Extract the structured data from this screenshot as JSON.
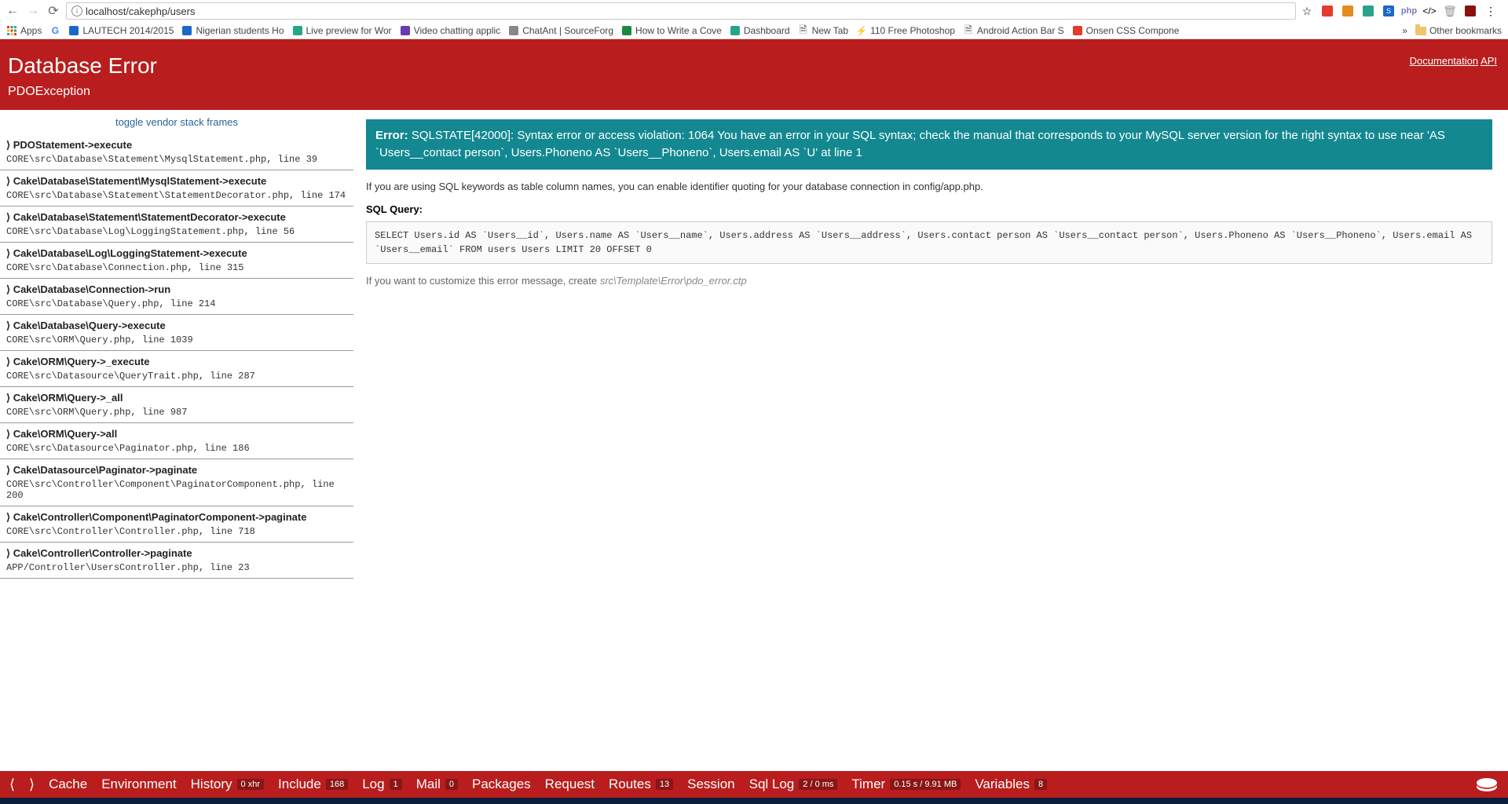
{
  "url": "localhost/cakephp/users",
  "bookmarks": {
    "apps": "Apps",
    "items": [
      {
        "label": "LAUTECH 2014/2015"
      },
      {
        "label": "Nigerian students Ho"
      },
      {
        "label": "Live preview for Wor"
      },
      {
        "label": "Video chatting applic"
      },
      {
        "label": "ChatAnt | SourceForg"
      },
      {
        "label": "How to Write a Cove"
      },
      {
        "label": "Dashboard"
      },
      {
        "label": "New Tab"
      },
      {
        "label": "110 Free Photoshop"
      },
      {
        "label": "Android Action Bar S"
      },
      {
        "label": "Onsen CSS Compone"
      }
    ],
    "other": "Other bookmarks"
  },
  "header": {
    "title": "Database Error",
    "exception": "PDOException",
    "doc": "Documentation",
    "api": "API"
  },
  "toggle": "toggle vendor stack frames",
  "stack": [
    {
      "call": "PDOStatement->execute",
      "file": "CORE\\src\\Database\\Statement\\MysqlStatement.php, line 39"
    },
    {
      "call": "Cake\\Database\\Statement\\MysqlStatement->execute",
      "file": "CORE\\src\\Database\\Statement\\StatementDecorator.php, line 174"
    },
    {
      "call": "Cake\\Database\\Statement\\StatementDecorator->execute",
      "file": "CORE\\src\\Database\\Log\\LoggingStatement.php, line 56"
    },
    {
      "call": "Cake\\Database\\Log\\LoggingStatement->execute",
      "file": "CORE\\src\\Database\\Connection.php, line 315"
    },
    {
      "call": "Cake\\Database\\Connection->run",
      "file": "CORE\\src\\Database\\Query.php, line 214"
    },
    {
      "call": "Cake\\Database\\Query->execute",
      "file": "CORE\\src\\ORM\\Query.php, line 1039"
    },
    {
      "call": "Cake\\ORM\\Query->_execute",
      "file": "CORE\\src\\Datasource\\QueryTrait.php, line 287"
    },
    {
      "call": "Cake\\ORM\\Query->_all",
      "file": "CORE\\src\\ORM\\Query.php, line 987"
    },
    {
      "call": "Cake\\ORM\\Query->all",
      "file": "CORE\\src\\Datasource\\Paginator.php, line 186"
    },
    {
      "call": "Cake\\Datasource\\Paginator->paginate",
      "file": "CORE\\src\\Controller\\Component\\PaginatorComponent.php, line 200"
    },
    {
      "call": "Cake\\Controller\\Component\\PaginatorComponent->paginate",
      "file": "CORE\\src\\Controller\\Controller.php, line 718"
    },
    {
      "call": "Cake\\Controller\\Controller->paginate",
      "file": "APP/Controller\\UsersController.php, line 23"
    }
  ],
  "error": {
    "label": "Error:",
    "message": "SQLSTATE[42000]: Syntax error or access violation: 1064 You have an error in your SQL syntax; check the manual that corresponds to your MySQL server version for the right syntax to use near 'AS `Users__contact person`, Users.Phoneno AS `Users__Phoneno`, Users.email AS `U' at line 1"
  },
  "hint": "If you are using SQL keywords as table column names, you can enable identifier quoting for your database connection in config/app.php.",
  "sql_label": "SQL Query:",
  "sql": "SELECT Users.id AS `Users__id`, Users.name AS `Users__name`, Users.address AS `Users__address`, Users.contact person AS `Users__contact person`, Users.Phoneno AS `Users__Phoneno`, Users.email AS `Users__email` FROM users Users LIMIT 20 OFFSET 0",
  "customize_prefix": "If you want to customize this error message, create ",
  "customize_path": "src\\Template\\Error\\pdo_error.ctp",
  "debugbar": {
    "cache": "Cache",
    "env": "Environment",
    "history": "History",
    "history_badge": "0 xhr",
    "include": "Include",
    "include_badge": "168",
    "log": "Log",
    "log_badge": "1",
    "mail": "Mail",
    "mail_badge": "0",
    "packages": "Packages",
    "request": "Request",
    "routes": "Routes",
    "routes_badge": "13",
    "session": "Session",
    "sqllog": "Sql Log",
    "sqllog_badge": "2 / 0 ms",
    "timer": "Timer",
    "timer_badge": "0.15 s / 9.91 MB",
    "variables": "Variables",
    "variables_badge": "8"
  }
}
